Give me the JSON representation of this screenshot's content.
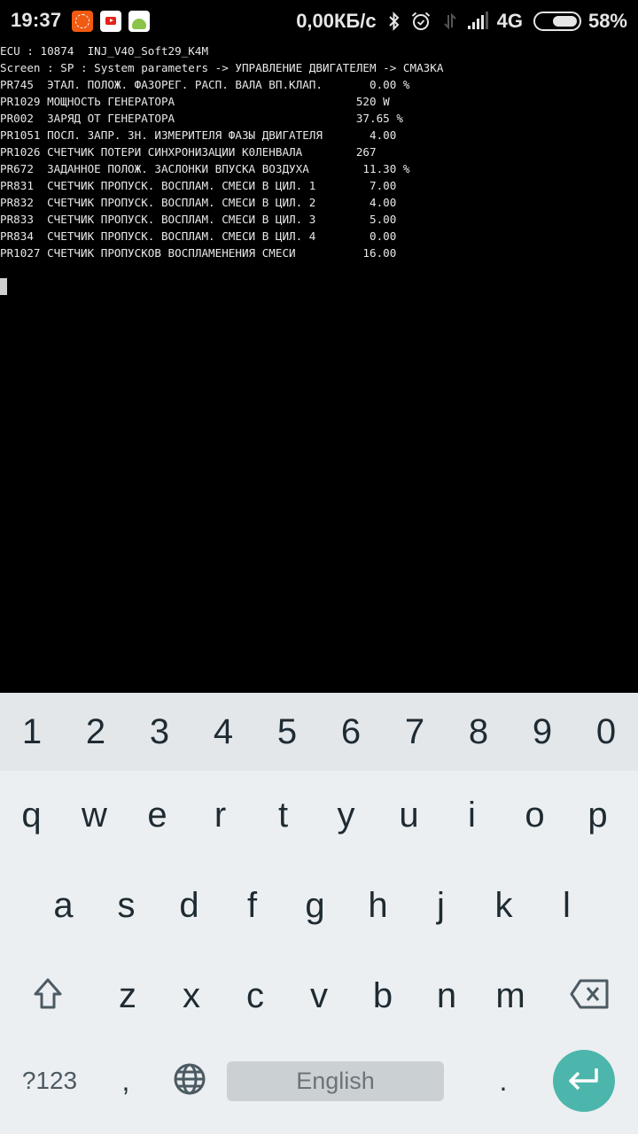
{
  "status_bar": {
    "time": "19:37",
    "notification_icons": [
      "mi-recorder-icon",
      "youtube-icon",
      "android-app-icon"
    ],
    "network_speed": "0,00КБ/с",
    "icons": [
      "bluetooth-icon",
      "alarm-icon",
      "data-transfer-icon",
      "signal-icon"
    ],
    "network_type": "4G",
    "battery_percent": "58%",
    "battery_level": 0.58
  },
  "terminal": {
    "lines": [
      "ECU : 10874  INJ_V40_Soft29_K4M",
      "Screen : SP : System parameters -> УПРАВЛЕНИЕ ДВИГАТЕЛЕМ -> СМАЗКА",
      "PR745  ЭТАЛ. ПОЛОЖ. ФАЗОРЕГ. РАСП. ВАЛА ВП.КЛАП.       0.00 %",
      "PR1029 МОЩНОСТЬ ГЕНЕРАТОРА                           520 W",
      "PR002  ЗАРЯД ОТ ГЕНЕРАТОРА                           37.65 %",
      "PR1051 ПОСЛ. ЗАПР. ЗН. ИЗМЕРИТЕЛЯ ФАЗЫ ДВИГАТЕЛЯ       4.00",
      "PR1026 СЧЕТЧИК ПОТЕРИ СИНХРОНИЗАЦИИ К0ЛЕНВАЛА        267",
      "PR672  ЗАДАННОЕ ПОЛОЖ. ЗАСЛОНКИ ВПУСКА ВОЗДУХА        11.30 %",
      "PR831  СЧЕТЧИК ПРОПУСК. ВОСПЛАМ. СМЕСИ В ЦИЛ. 1        7.00",
      "PR832  СЧЕТЧИК ПРОПУСК. ВОСПЛАМ. СМЕСИ В ЦИЛ. 2        4.00",
      "PR833  СЧЕТЧИК ПРОПУСК. ВОСПЛАМ. СМЕСИ В ЦИЛ. 3        5.00",
      "PR834  СЧЕТЧИК ПРОПУСК. ВОСПЛАМ. СМЕСИ В ЦИЛ. 4        0.00",
      "PR1027 СЧЕТЧИК ПРОПУСКОВ ВОСПЛАМЕНЕНИЯ СМЕСИ          16.00"
    ]
  },
  "keyboard": {
    "number_row": [
      "1",
      "2",
      "3",
      "4",
      "5",
      "6",
      "7",
      "8",
      "9",
      "0"
    ],
    "row1": [
      "q",
      "w",
      "e",
      "r",
      "t",
      "y",
      "u",
      "i",
      "o",
      "p"
    ],
    "row2": [
      "a",
      "s",
      "d",
      "f",
      "g",
      "h",
      "j",
      "k",
      "l"
    ],
    "row3": [
      "z",
      "x",
      "c",
      "v",
      "b",
      "n",
      "m"
    ],
    "symbols_label": "?123",
    "comma": ",",
    "spacebar_label": "English",
    "period": ".",
    "enter_color": "#4db6ac"
  }
}
